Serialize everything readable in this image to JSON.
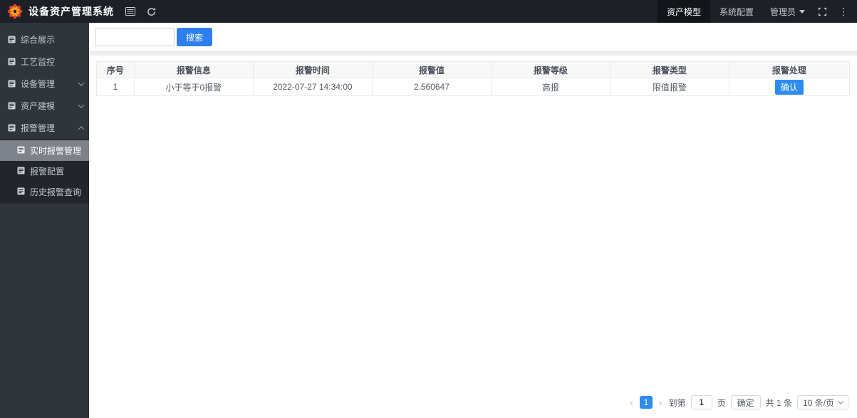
{
  "navbar": {
    "title": "设备资产管理系统",
    "tabs": [
      {
        "label": "资产模型",
        "active": true
      },
      {
        "label": "系统配置",
        "active": false
      }
    ],
    "user_label": "管理员"
  },
  "icons": {
    "more_dots": "⋮",
    "pager_prev": "‹",
    "pager_next": "›"
  },
  "sidebar": {
    "items": [
      {
        "label": "综合展示"
      },
      {
        "label": "工艺监控"
      },
      {
        "label": "设备管理",
        "chevron": "down"
      },
      {
        "label": "资产建模",
        "chevron": "down"
      },
      {
        "label": "报警管理",
        "chevron": "up"
      }
    ],
    "submenu": [
      {
        "label": "实时报警管理",
        "active": true
      },
      {
        "label": "报警配置",
        "active": false
      },
      {
        "label": "历史报警查询",
        "active": false
      }
    ]
  },
  "search": {
    "value": "",
    "button_label": "搜索"
  },
  "table": {
    "columns": [
      "序号",
      "报警信息",
      "报警时间",
      "报警值",
      "报警等级",
      "报警类型",
      "报警处理"
    ],
    "rows": [
      {
        "index": "1",
        "info": "小于等于0报警",
        "time": "2022-07-27 14:34:00",
        "value": "2.560647",
        "level": "高报",
        "type": "限值报警",
        "action_label": "确认"
      }
    ]
  },
  "pagination": {
    "current_page": "1",
    "goto_label": "到第",
    "goto_value": "1",
    "page_unit_label": "页",
    "confirm_label": "确定",
    "total_label": "共 1 条",
    "page_size_label": "10 条/页"
  },
  "colors": {
    "primary": "#2d8cf0",
    "search_button": "#2d7ff0",
    "navbar_bg": "#1d2127",
    "sidebar_bg": "#30353c",
    "submenu_bg": "#22262c",
    "active_submenu_bg": "#7e828a",
    "table_header_bg": "#f8f8f9",
    "table_border": "#e8eaec"
  }
}
